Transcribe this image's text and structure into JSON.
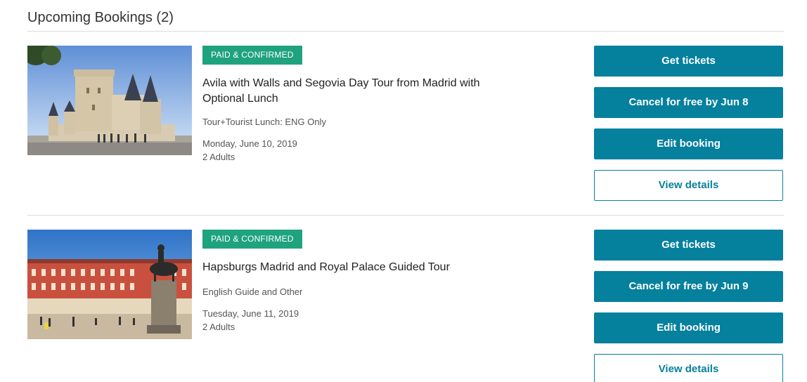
{
  "section": {
    "title": "Upcoming Bookings (2)"
  },
  "bookings": [
    {
      "status": "PAID & CONFIRMED",
      "title": "Avila with Walls and Segovia Day Tour from Madrid with Optional Lunch",
      "option": "Tour+Tourist Lunch: ENG Only",
      "date": "Monday, June 10, 2019",
      "travelers": "2 Adults",
      "actions": {
        "get_tickets": "Get tickets",
        "cancel": "Cancel for free by Jun 8",
        "edit": "Edit booking",
        "view": "View details"
      }
    },
    {
      "status": "PAID & CONFIRMED",
      "title": "Hapsburgs Madrid and Royal Palace Guided Tour",
      "option": "English Guide and Other",
      "date": "Tuesday, June 11, 2019",
      "travelers": "2 Adults",
      "actions": {
        "get_tickets": "Get tickets",
        "cancel": "Cancel for free by Jun 9",
        "edit": "Edit booking",
        "view": "View details"
      }
    }
  ],
  "colors": {
    "primary_button": "#05809d",
    "status_badge": "#1fa37f",
    "divider": "#dcdcdc"
  }
}
